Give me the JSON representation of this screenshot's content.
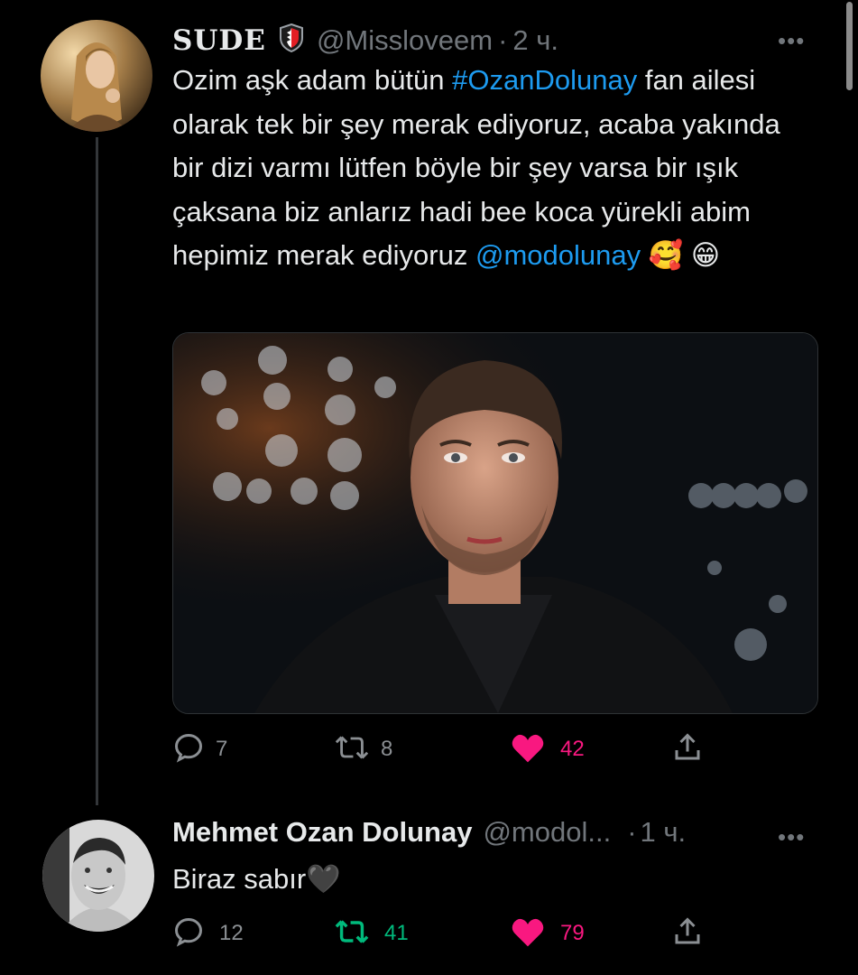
{
  "tweet1": {
    "display_name": "SUDE",
    "handle": "@Missloveem",
    "dot": "·",
    "time": "2 ч.",
    "more": "•••",
    "text_before": "Ozim aşk adam bütün ",
    "hashtag": "#OzanDolunay",
    "text_middle": " fan ailesi olarak tek bir şey merak ediyoruz, acaba yakında bir dizi varmı lütfen böyle bir şey varsa bir ışık çaksana biz anlarız hadi bee koca yürekli abim hepimiz merak ediyoruz ",
    "mention": "@modolunay",
    "emojis": " 🥰 😁",
    "actions": {
      "replies": "7",
      "retweets": "8",
      "likes": "42"
    }
  },
  "tweet2": {
    "display_name": "Mehmet Ozan Dolunay",
    "handle": "@modol...",
    "dot": "·",
    "time": "1 ч.",
    "more": "•••",
    "text": "Biraz sabır🖤",
    "actions": {
      "replies": "12",
      "retweets": "41",
      "likes": "79"
    }
  },
  "colors": {
    "background": "#000000",
    "text": "#e7e9ea",
    "muted": "#71767b",
    "link": "#1d9bf0",
    "like_active": "#f91880",
    "retweet_active": "#00ba7c"
  },
  "icons": [
    "verified-badge-icon",
    "reply-icon",
    "retweet-icon",
    "like-icon",
    "share-icon",
    "more-icon"
  ]
}
